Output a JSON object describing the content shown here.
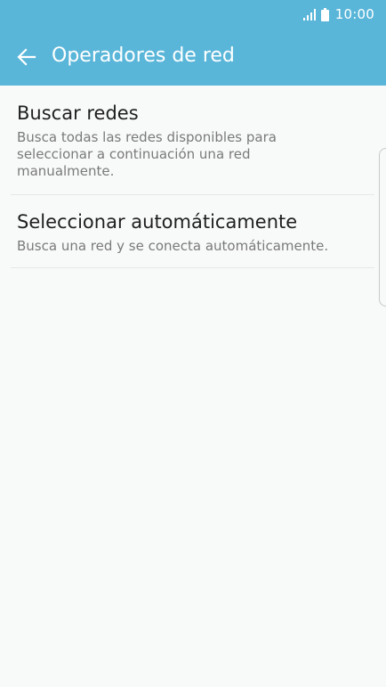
{
  "status_bar": {
    "time": "10:00",
    "signal_icon": "signal-icon",
    "battery_icon": "battery-icon"
  },
  "app_bar": {
    "title": "Operadores de red",
    "back_icon": "arrow-left-icon",
    "color": "#5ab6d9"
  },
  "options": [
    {
      "title": "Buscar redes",
      "description": "Busca todas las redes disponibles para seleccionar a continuación una red manualmente."
    },
    {
      "title": "Seleccionar automáticamente",
      "description": "Busca una red y se conecta automáticamente."
    }
  ]
}
